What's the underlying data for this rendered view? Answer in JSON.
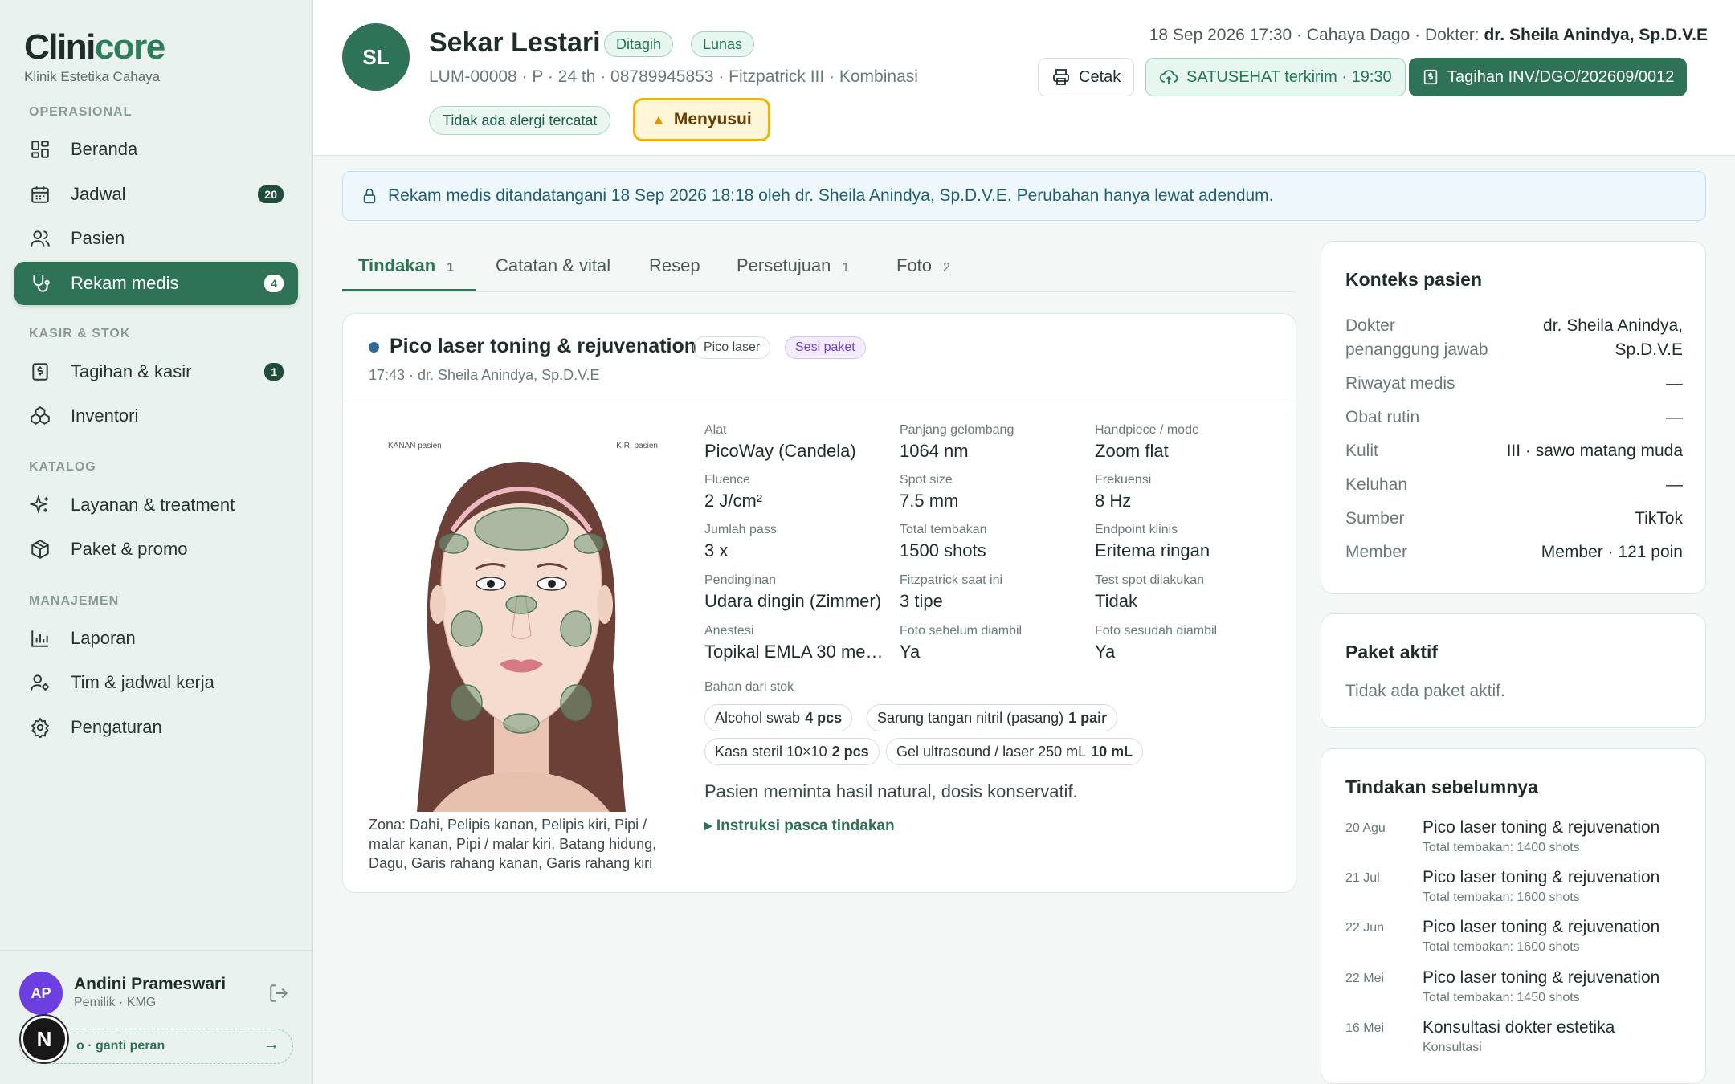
{
  "brand": {
    "name_a": "Clini",
    "name_b": "core",
    "subtitle": "Klinik Estetika Cahaya"
  },
  "sidebar": {
    "sections": [
      "OPERASIONAL",
      "KASIR & STOK",
      "KATALOG",
      "MANAJEMEN"
    ],
    "items": [
      {
        "label": "Beranda",
        "icon": "dashboard-icon"
      },
      {
        "label": "Jadwal",
        "icon": "calendar-icon",
        "badge": "20"
      },
      {
        "label": "Pasien",
        "icon": "users-icon"
      },
      {
        "label": "Rekam medis",
        "icon": "stethoscope-icon",
        "badge": "4",
        "active": true
      },
      {
        "label": "Tagihan & kasir",
        "icon": "receipt-icon",
        "badge": "1"
      },
      {
        "label": "Inventori",
        "icon": "boxes-icon"
      },
      {
        "label": "Layanan & treatment",
        "icon": "sparkles-icon"
      },
      {
        "label": "Paket & promo",
        "icon": "package-icon"
      },
      {
        "label": "Laporan",
        "icon": "bar-chart-icon"
      },
      {
        "label": "Tim & jadwal kerja",
        "icon": "user-cog-icon"
      },
      {
        "label": "Pengaturan",
        "icon": "settings-icon"
      }
    ]
  },
  "user": {
    "initials": "AP",
    "name": "Andini Prameswari",
    "role": "Pemilik · KMG",
    "switch_label": "o · ganti peran",
    "switch_arrow": "→",
    "overlay_letter": "N"
  },
  "patient": {
    "initials": "SL",
    "name": "Sekar Lestari",
    "badges": [
      "Ditagih",
      "Lunas"
    ],
    "meta": "LUM-00008 · P · 24 th · 08789945853 · Fitzpatrick III · Kombinasi",
    "allergy": "Tidak ada alergi tercatat",
    "alert": "Menyusui",
    "alert_icon": "▲"
  },
  "visit": {
    "prefix": "18 Sep 2026 17:30 · Cahaya Dago · Dokter: ",
    "doctor": "dr. Sheila Anindya, Sp.D.V.E"
  },
  "actions": {
    "print": "Cetak",
    "satusehat": "SATUSEHAT terkirim · 19:30",
    "invoice": "Tagihan INV/DGO/202609/0012"
  },
  "notice": "Rekam medis ditandatangani 18 Sep 2026 18:18 oleh dr. Sheila Anindya, Sp.D.V.E. Perubahan hanya lewat adendum.",
  "tabs": [
    {
      "label": "Tindakan",
      "count": "1"
    },
    {
      "label": "Catatan & vital",
      "count": ""
    },
    {
      "label": "Resep",
      "count": ""
    },
    {
      "label": "Persetujuan",
      "count": "1"
    },
    {
      "label": "Foto",
      "count": "2"
    }
  ],
  "treatment": {
    "title": "Pico laser toning & rejuvenation",
    "tags": [
      "Pico laser",
      "Sesi paket"
    ],
    "sub": "17:43 · dr. Sheila Anindya, Sp.D.V.E",
    "face_labels": {
      "right": "KANAN pasien",
      "left": "KIRI pasien"
    },
    "zones": "Zona: Dahi, Pelipis kanan, Pelipis kiri, Pipi / malar kanan, Pipi / malar kiri, Batang hidung, Dagu, Garis rahang kanan, Garis rahang kiri",
    "params": [
      {
        "k": "Alat",
        "v": "PicoWay (Candela)"
      },
      {
        "k": "Panjang gelombang",
        "v": "1064 nm"
      },
      {
        "k": "Handpiece / mode",
        "v": "Zoom flat"
      },
      {
        "k": "Fluence",
        "v": "2 J/cm²"
      },
      {
        "k": "Spot size",
        "v": "7.5 mm"
      },
      {
        "k": "Frekuensi",
        "v": "8 Hz"
      },
      {
        "k": "Jumlah pass",
        "v": "3 x"
      },
      {
        "k": "Total tembakan",
        "v": "1500 shots"
      },
      {
        "k": "Endpoint klinis",
        "v": "Eritema ringan"
      },
      {
        "k": "Pendinginan",
        "v": "Udara dingin (Zimmer)"
      },
      {
        "k": "Fitzpatrick saat ini",
        "v": "3 tipe"
      },
      {
        "k": "Test spot dilakukan",
        "v": "Tidak"
      },
      {
        "k": "Anestesi",
        "v": "Topikal EMLA 30 me…"
      },
      {
        "k": "Foto sebelum diambil",
        "v": "Ya"
      },
      {
        "k": "Foto sesudah diambil",
        "v": "Ya"
      }
    ],
    "stock_label": "Bahan dari stok",
    "stock": [
      {
        "name": "Alcohol swab",
        "qty": "4 pcs"
      },
      {
        "name": "Sarung tangan nitril (pasang)",
        "qty": "1 pair"
      },
      {
        "name": "Kasa steril 10×10",
        "qty": "2 pcs"
      },
      {
        "name": "Gel ultrasound / laser 250 mL",
        "qty": "10 mL"
      }
    ],
    "note": "Pasien meminta hasil natural, dosis konservatif.",
    "instructions": "▸ Instruksi pasca tindakan"
  },
  "context": {
    "title": "Konteks pasien",
    "rows": [
      {
        "k": "Dokter\npenanggung jawab",
        "v": "dr. Sheila Anindya,\nSp.D.V.E"
      },
      {
        "k": "Riwayat medis",
        "v": "—"
      },
      {
        "k": "Obat rutin",
        "v": "—"
      },
      {
        "k": "Kulit",
        "v": "III · sawo matang muda"
      },
      {
        "k": "Keluhan",
        "v": "—"
      },
      {
        "k": "Sumber",
        "v": "TikTok"
      },
      {
        "k": "Member",
        "v": "Member · 121 poin"
      }
    ]
  },
  "paket": {
    "title": "Paket aktif",
    "empty": "Tidak ada paket aktif."
  },
  "history": {
    "title": "Tindakan sebelumnya",
    "items": [
      {
        "date": "20 Agu",
        "title": "Pico laser toning & rejuvenation",
        "sub": "Total tembakan: 1400 shots"
      },
      {
        "date": "21 Jul",
        "title": "Pico laser toning & rejuvenation",
        "sub": "Total tembakan: 1600 shots"
      },
      {
        "date": "22 Jun",
        "title": "Pico laser toning & rejuvenation",
        "sub": "Total tembakan: 1600 shots"
      },
      {
        "date": "22 Mei",
        "title": "Pico laser toning & rejuvenation",
        "sub": "Total tembakan: 1450 shots"
      },
      {
        "date": "16 Mei",
        "title": "Konsultasi dokter estetika",
        "sub": "Konsultasi"
      }
    ]
  },
  "colors": {
    "primary": "#2e7356",
    "sidebar_bg": "#e9f2ee",
    "alert_border": "#f2b400",
    "zone_fill": "#6f9a7e"
  }
}
